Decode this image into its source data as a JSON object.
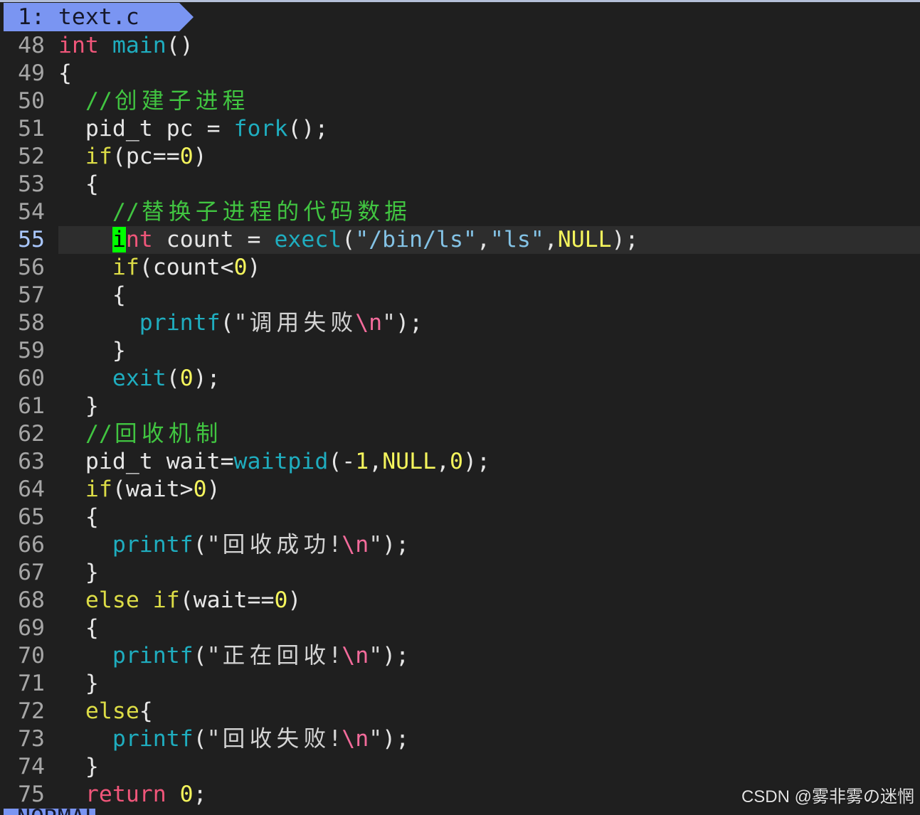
{
  "tabline": {
    "tab_label": "1: text.c"
  },
  "theme": {
    "background": "#1f1f1f",
    "text": "#e6e6e6",
    "line_number": "#a6a6a6",
    "current_line_number": "#a9c7ff",
    "current_line_background": "#2d2d2d",
    "tab_background": "#7a95f2",
    "tab_text": "#16182a"
  },
  "editor": {
    "lines": [
      {
        "number": "48",
        "tokens": [
          [
            "int",
            "#f0567a"
          ],
          [
            " main",
            "#1fadbf"
          ],
          [
            "()",
            "#e6e6e6"
          ]
        ]
      },
      {
        "number": "49",
        "tokens": [
          [
            "{",
            "#e6e6e6"
          ]
        ]
      },
      {
        "number": "50",
        "tokens": [
          [
            "  //创建子进程",
            "#41c541"
          ]
        ]
      },
      {
        "number": "51",
        "tokens": [
          [
            "  pid_t pc = ",
            "#e6e6e6"
          ],
          [
            "fork",
            "#1fadbf"
          ],
          [
            "();",
            "#e6e6e6"
          ]
        ]
      },
      {
        "number": "52",
        "tokens": [
          [
            "  if",
            "#dcdc46"
          ],
          [
            "(pc==",
            "#e6e6e6"
          ],
          [
            "0",
            "#f4f45c"
          ],
          [
            ")",
            "#e6e6e6"
          ]
        ]
      },
      {
        "number": "53",
        "tokens": [
          [
            "  {",
            "#e6e6e6"
          ]
        ]
      },
      {
        "number": "54",
        "tokens": [
          [
            "    //替换子进程的代码数据",
            "#41c541"
          ]
        ]
      },
      {
        "number": "55",
        "current": true,
        "tokens": [
          [
            "    ",
            "#e6e6e6"
          ],
          [
            "i",
            "#000000",
            "#00ff00"
          ],
          [
            "nt",
            "#f0567a"
          ],
          [
            " count = ",
            "#e6e6e6"
          ],
          [
            "execl",
            "#1fadbf"
          ],
          [
            "(",
            "#e6e6e6"
          ],
          [
            "\"/bin/ls\"",
            "#84c3e6"
          ],
          [
            ",",
            "#e6e6e6"
          ],
          [
            "\"ls\"",
            "#84c3e6"
          ],
          [
            ",",
            "#e6e6e6"
          ],
          [
            "NULL",
            "#f4f45c"
          ],
          [
            ");",
            "#e6e6e6"
          ]
        ]
      },
      {
        "number": "56",
        "tokens": [
          [
            "    if",
            "#dcdc46"
          ],
          [
            "(count<",
            "#e6e6e6"
          ],
          [
            "0",
            "#f4f45c"
          ],
          [
            ")",
            "#e6e6e6"
          ]
        ]
      },
      {
        "number": "57",
        "tokens": [
          [
            "    {",
            "#e6e6e6"
          ]
        ]
      },
      {
        "number": "58",
        "tokens": [
          [
            "      printf",
            "#1fadbf"
          ],
          [
            "(",
            "#e6e6e6"
          ],
          [
            "\"调用失败",
            "#d4d4d4"
          ],
          [
            "\\n",
            "#f36b9b"
          ],
          [
            "\"",
            "#d4d4d4"
          ],
          [
            ");",
            "#e6e6e6"
          ]
        ]
      },
      {
        "number": "59",
        "tokens": [
          [
            "    }",
            "#e6e6e6"
          ]
        ]
      },
      {
        "number": "60",
        "tokens": [
          [
            "    exit",
            "#1fadbf"
          ],
          [
            "(",
            "#e6e6e6"
          ],
          [
            "0",
            "#f4f45c"
          ],
          [
            ");",
            "#e6e6e6"
          ]
        ]
      },
      {
        "number": "61",
        "tokens": [
          [
            "  }",
            "#e6e6e6"
          ]
        ]
      },
      {
        "number": "62",
        "tokens": [
          [
            "  //回收机制",
            "#41c541"
          ]
        ]
      },
      {
        "number": "63",
        "tokens": [
          [
            "  pid_t wait=",
            "#e6e6e6"
          ],
          [
            "waitpid",
            "#1fadbf"
          ],
          [
            "(-",
            "#e6e6e6"
          ],
          [
            "1",
            "#f4f45c"
          ],
          [
            ",",
            "#e6e6e6"
          ],
          [
            "NULL",
            "#f4f45c"
          ],
          [
            ",",
            "#e6e6e6"
          ],
          [
            "0",
            "#f4f45c"
          ],
          [
            ");",
            "#e6e6e6"
          ]
        ]
      },
      {
        "number": "64",
        "tokens": [
          [
            "  if",
            "#dcdc46"
          ],
          [
            "(wait>",
            "#e6e6e6"
          ],
          [
            "0",
            "#f4f45c"
          ],
          [
            ")",
            "#e6e6e6"
          ]
        ]
      },
      {
        "number": "65",
        "tokens": [
          [
            "  {",
            "#e6e6e6"
          ]
        ]
      },
      {
        "number": "66",
        "tokens": [
          [
            "    printf",
            "#1fadbf"
          ],
          [
            "(",
            "#e6e6e6"
          ],
          [
            "\"回收成功!",
            "#d4d4d4"
          ],
          [
            "\\n",
            "#f36b9b"
          ],
          [
            "\"",
            "#d4d4d4"
          ],
          [
            ");",
            "#e6e6e6"
          ]
        ]
      },
      {
        "number": "67",
        "tokens": [
          [
            "  }",
            "#e6e6e6"
          ]
        ]
      },
      {
        "number": "68",
        "tokens": [
          [
            "  else if",
            "#dcdc46"
          ],
          [
            "(wait==",
            "#e6e6e6"
          ],
          [
            "0",
            "#f4f45c"
          ],
          [
            ")",
            "#e6e6e6"
          ]
        ]
      },
      {
        "number": "69",
        "tokens": [
          [
            "  {",
            "#e6e6e6"
          ]
        ]
      },
      {
        "number": "70",
        "tokens": [
          [
            "    printf",
            "#1fadbf"
          ],
          [
            "(",
            "#e6e6e6"
          ],
          [
            "\"正在回收!",
            "#d4d4d4"
          ],
          [
            "\\n",
            "#f36b9b"
          ],
          [
            "\"",
            "#d4d4d4"
          ],
          [
            ");",
            "#e6e6e6"
          ]
        ]
      },
      {
        "number": "71",
        "tokens": [
          [
            "  }",
            "#e6e6e6"
          ]
        ]
      },
      {
        "number": "72",
        "tokens": [
          [
            "  else",
            "#dcdc46"
          ],
          [
            "{",
            "#e6e6e6"
          ]
        ]
      },
      {
        "number": "73",
        "tokens": [
          [
            "    printf",
            "#1fadbf"
          ],
          [
            "(",
            "#e6e6e6"
          ],
          [
            "\"回收失败!",
            "#d4d4d4"
          ],
          [
            "\\n",
            "#f36b9b"
          ],
          [
            "\"",
            "#d4d4d4"
          ],
          [
            ");",
            "#e6e6e6"
          ]
        ]
      },
      {
        "number": "74",
        "tokens": [
          [
            "  }",
            "#e6e6e6"
          ]
        ]
      },
      {
        "number": "75",
        "tokens": [
          [
            "  return",
            "#f0567a"
          ],
          [
            " 0",
            "#f4f45c"
          ],
          [
            ";",
            "#e6e6e6"
          ]
        ]
      }
    ]
  },
  "statusline": {
    "mode": "NORMAL"
  },
  "watermark": "CSDN @雾非雾の迷惘"
}
